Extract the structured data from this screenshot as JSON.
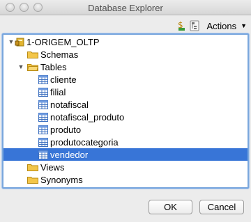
{
  "window": {
    "title": "Database Explorer"
  },
  "toolbar": {
    "actions_label": "Actions"
  },
  "tree": {
    "root": {
      "label": "1-ORIGEM_OLTP",
      "expanded": true
    },
    "folders": {
      "schemas": "Schemas",
      "tables": "Tables",
      "views": "Views",
      "synonyms": "Synonyms"
    },
    "tables": [
      {
        "label": "cliente"
      },
      {
        "label": "filial"
      },
      {
        "label": "notafiscal"
      },
      {
        "label": "notafiscal_produto"
      },
      {
        "label": "produto"
      },
      {
        "label": "produtocategoria"
      },
      {
        "label": "vendedor",
        "selected": true
      }
    ]
  },
  "footer": {
    "ok_label": "OK",
    "cancel_label": "Cancel"
  },
  "colors": {
    "selection": "#3875d7",
    "focus_border": "#7aa7dd"
  }
}
